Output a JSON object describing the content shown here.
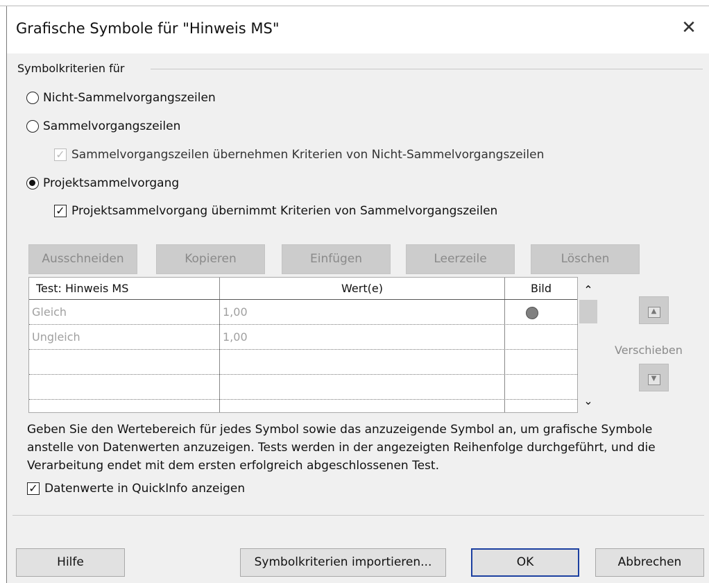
{
  "dialog": {
    "title": "Grafische Symbole für \"Hinweis MS\"",
    "close_glyph": "✕"
  },
  "criteria": {
    "group_label": "Symbolkriterien für",
    "options": [
      {
        "label": "Nicht-Sammelvorgangszeilen",
        "selected": false
      },
      {
        "label": "Sammelvorgangszeilen",
        "selected": false
      },
      {
        "label": "Projektsammelvorgang",
        "selected": true
      }
    ],
    "summary_inherit": {
      "label": "Sammelvorgangszeilen übernehmen Kriterien von Nicht-Sammelvorgangszeilen",
      "checked": true,
      "enabled": false
    },
    "project_inherit": {
      "label": "Projektsammelvorgang übernimmt Kriterien von Sammelvorgangszeilen",
      "checked": true,
      "enabled": true
    }
  },
  "toolbar": {
    "cut": "Ausschneiden",
    "copy": "Kopieren",
    "paste": "Einfügen",
    "blank_row": "Leerzeile",
    "delete": "Löschen"
  },
  "grid": {
    "columns": [
      "Test: Hinweis MS",
      "Wert(e)",
      "Bild"
    ],
    "rows": [
      {
        "test": "Gleich",
        "value": "1,00",
        "image": "gray-circle-icon"
      },
      {
        "test": "Ungleich",
        "value": "1,00",
        "image": ""
      },
      {
        "test": "",
        "value": "",
        "image": ""
      },
      {
        "test": "",
        "value": "",
        "image": ""
      }
    ],
    "colors": {
      "disabled_text": "#a0a0a0",
      "circle": "#808080"
    }
  },
  "move": {
    "label": "Verschieben",
    "up_icon": "▲",
    "down_icon": "▼"
  },
  "description": "Geben Sie den Wertebereich für jedes Symbol sowie das anzuzeigende Symbol an, um grafische Symbole anstelle von Datenwerten anzuzeigen. Tests werden in der angezeigten Reihenfolge durchgeführt, und die Verarbeitung endet mit dem ersten erfolgreich abgeschlossenen Test.",
  "show_values_tooltip": {
    "label": "Datenwerte in QuickInfo anzeigen",
    "checked": true
  },
  "buttons": {
    "help": "Hilfe",
    "import": "Symbolkriterien importieren...",
    "ok": "OK",
    "cancel": "Abbrechen"
  },
  "accent_color": "#1b3fa0"
}
